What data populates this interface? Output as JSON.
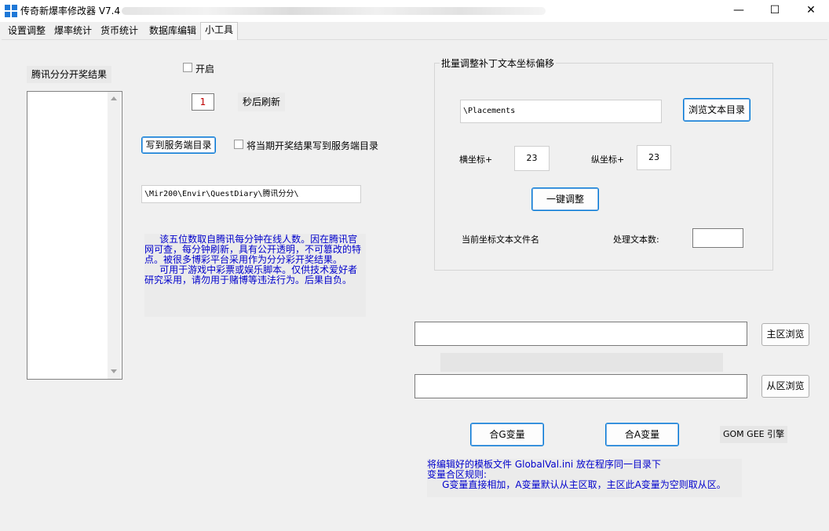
{
  "window": {
    "title": "传奇新爆率修改器 V7.4",
    "minimize_glyph": "—",
    "maximize_glyph": "☐",
    "close_glyph": "✕",
    "accent": "#1e78d7"
  },
  "tabs": [
    {
      "label": "设置调整"
    },
    {
      "label": "爆率统计"
    },
    {
      "label": "货币统计"
    },
    {
      "label": "数据库编辑"
    },
    {
      "label": "小工具"
    }
  ],
  "left": {
    "list_title": "腾讯分分开奖结果",
    "enable_label": "开启",
    "refresh_value": "1",
    "refresh_label": "秒后刷新",
    "write_button": "写到服务端目录",
    "write_checkbox_label": "将当期开奖结果写到服务端目录",
    "path_value": "\\Mir200\\Envir\\QuestDiary\\腾讯分分\\",
    "note": "     该五位数取自腾讯每分钟在线人数。因在腾讯官\n网可查，每分钟刷新，具有公开透明，不可篡改的特\n点。被很多博彩平台采用作为分分彩开奖结果。\n     可用于游戏中彩票或娱乐脚本。仅供技术爱好者\n研究采用，请勿用于赌博等违法行为。后果自负。"
  },
  "batch": {
    "group_title": "批量调整补丁文本坐标偏移",
    "path_value": "\\Placements",
    "browse_button": "浏览文本目录",
    "x_label": "横坐标+",
    "x_value": "23",
    "y_label": "纵坐标+",
    "y_value": "23",
    "adjust_button": "一键调整",
    "current_file_label": "当前坐标文本文件名",
    "count_label": "处理文本数:",
    "count_value": ""
  },
  "merge": {
    "main_path": "",
    "main_browse": "主区浏览",
    "sub_path": "",
    "sub_browse": "从区浏览",
    "merge_g_button": "合G变量",
    "merge_a_button": "合A变量",
    "engine_label": "GOM GEE 引擎",
    "note": "将编辑好的模板文件 GlobalVal.ini 放在程序同一目录下\n变量合区规则:\n     G变量直接相加，A变量默认从主区取，主区此A变量为空则取从区。"
  }
}
